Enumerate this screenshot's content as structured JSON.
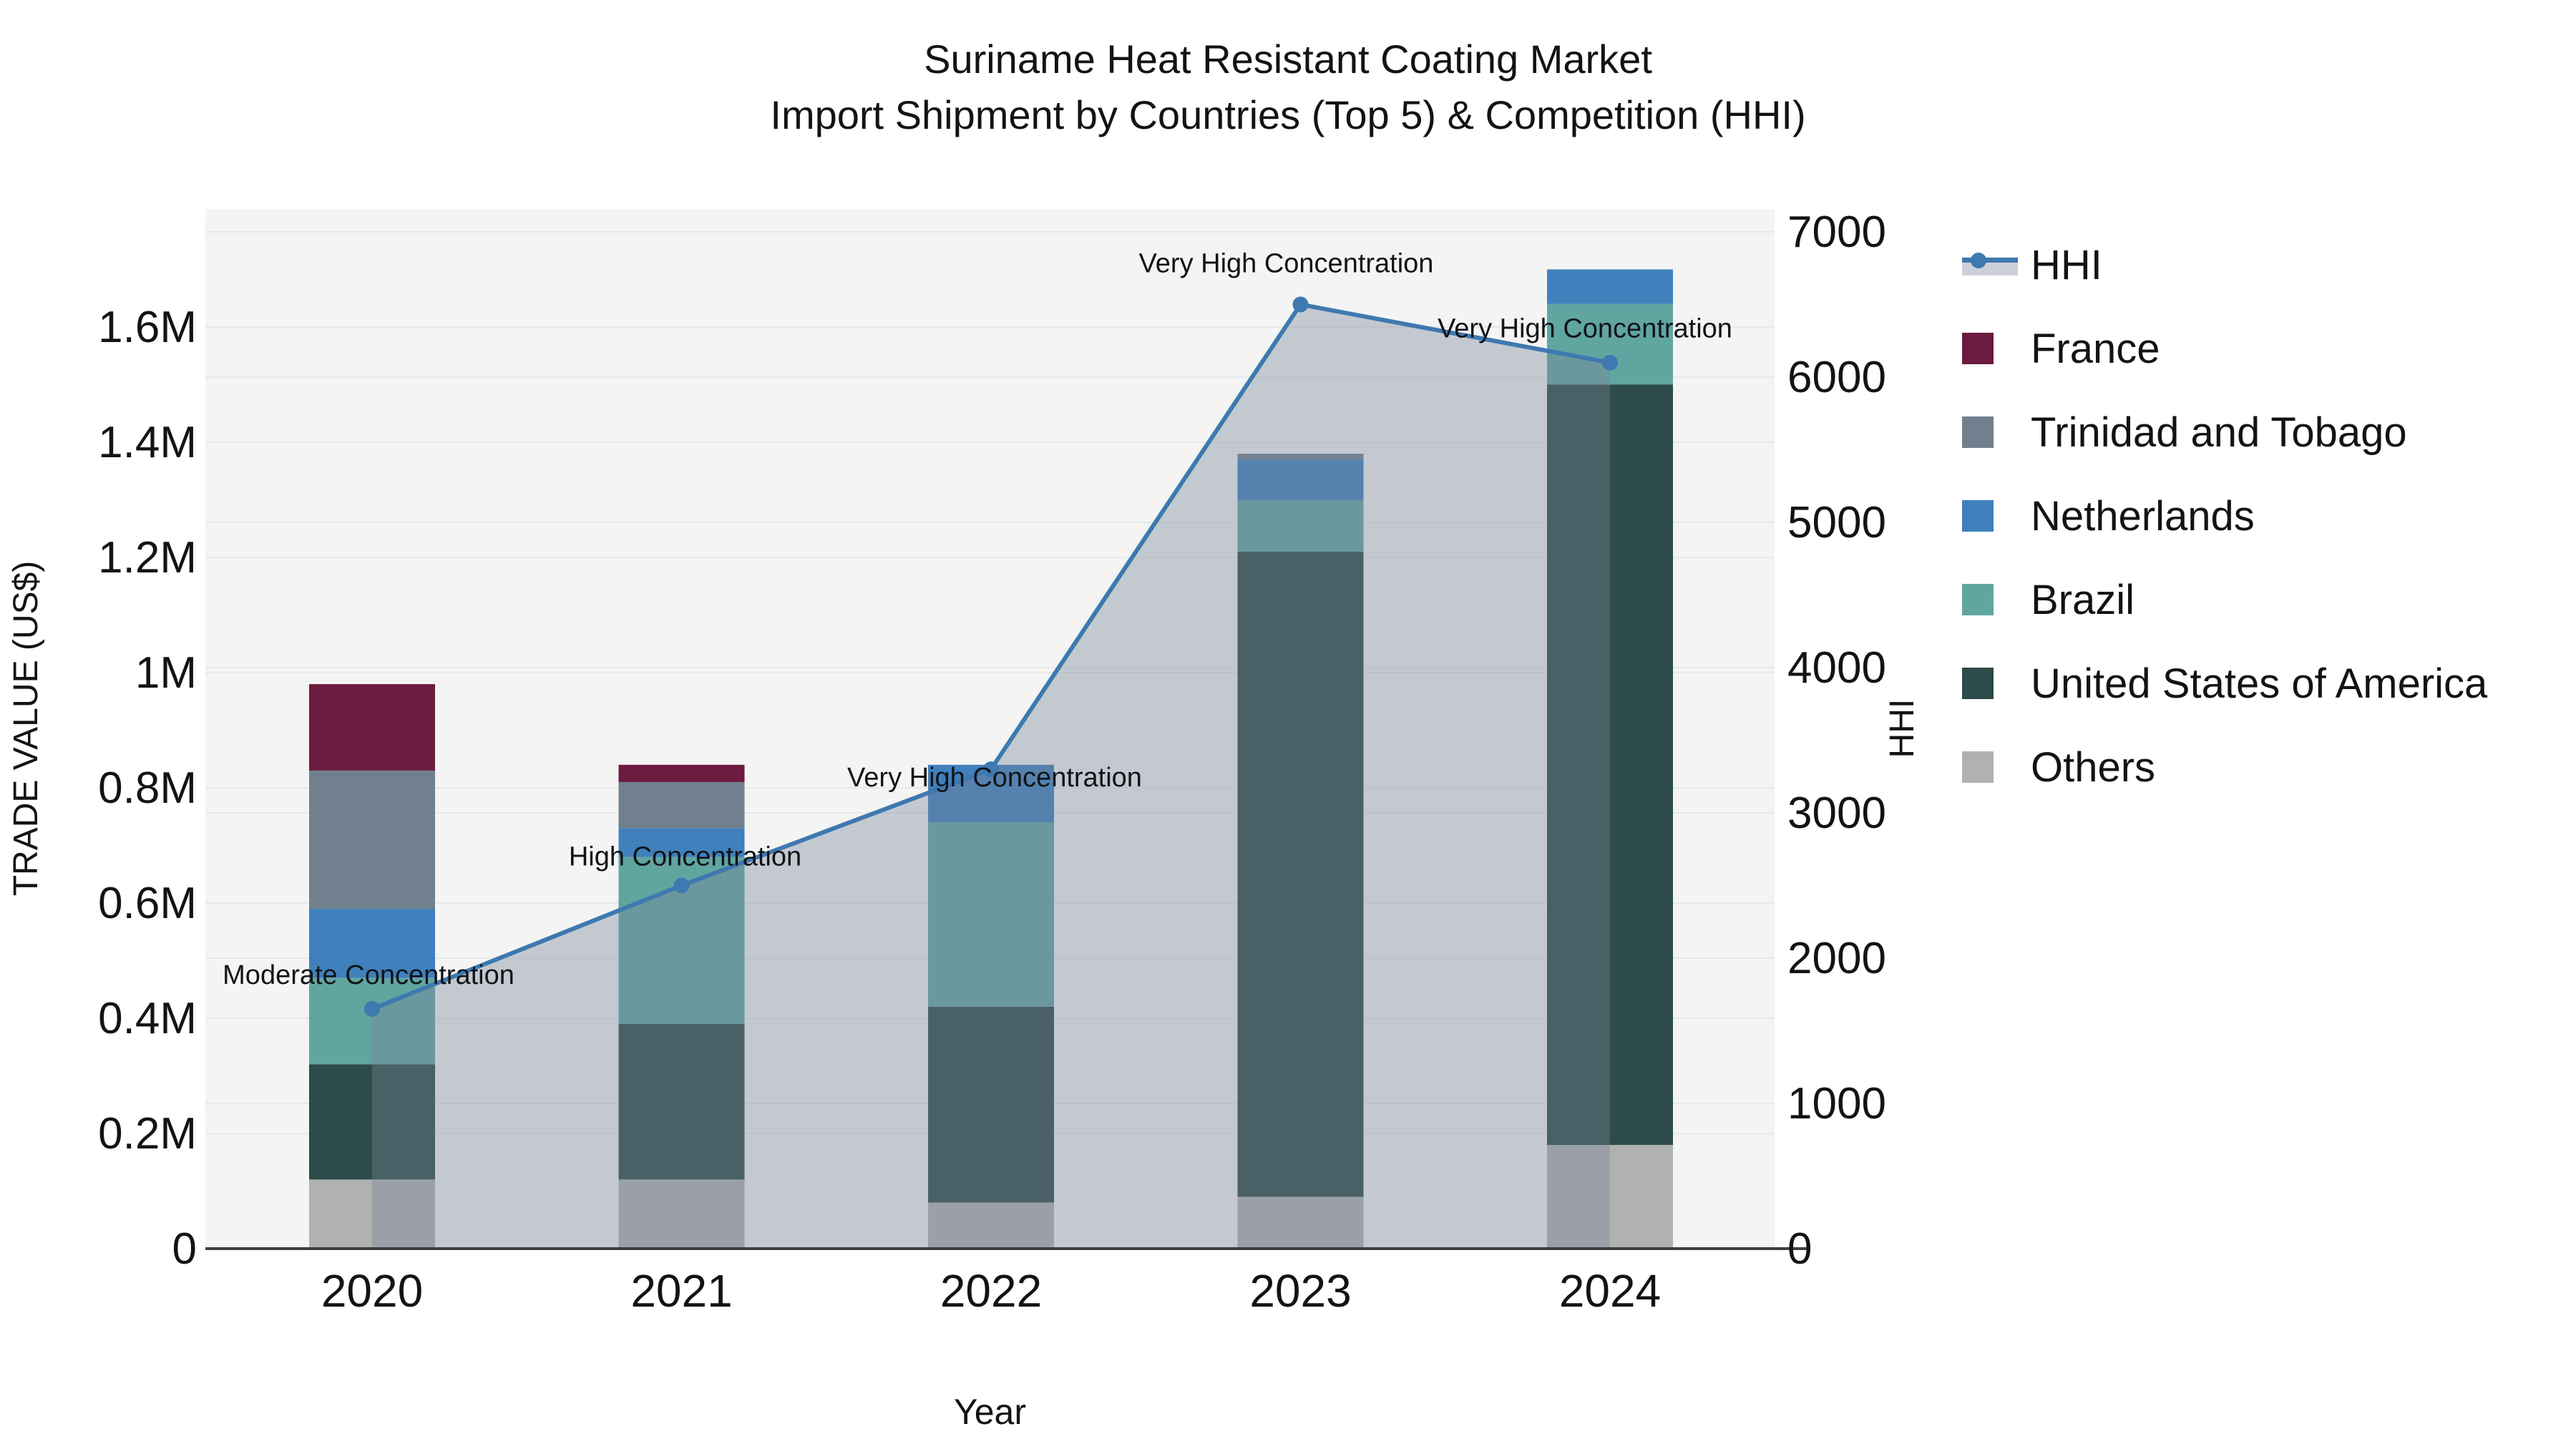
{
  "title": {
    "line1": "Suriname Heat Resistant Coating Market",
    "line2": "Import Shipment by Countries (Top 5) & Competition (HHI)"
  },
  "colors": {
    "page_bg": "#ffffff",
    "plot_bg": "#f3f4f3",
    "gridline": "#e7e8e9",
    "axis_line": "#3f3f3f",
    "text": "#111417",
    "hhi_line": "#3e79b0",
    "hhi_area": "rgba(122,132,155,0.38)",
    "france": "#6b1c3f",
    "trinidad_and_tobago": "#71808f",
    "netherlands": "#4080bc",
    "brazil": "#61a5a1",
    "united_states": "#2d4b48",
    "others": "#b0b2b1"
  },
  "chart_data": {
    "type": "combo: stacked-bar (left axis) + line-area (right axis)",
    "title": "Suriname Heat Resistant Coating Market — Import Shipment by Countries (Top 5) & Competition (HHI)",
    "categories": [
      "2020",
      "2021",
      "2022",
      "2023",
      "2024"
    ],
    "xlabel": "Year",
    "ylabel_left": "TRADE VALUE (US$)",
    "ylabel_right": "HHI",
    "bar_value_unit": "million US$",
    "y_left_ticks": [
      {
        "v": 0.0,
        "label": "0"
      },
      {
        "v": 0.2,
        "label": "0.2M"
      },
      {
        "v": 0.4,
        "label": "0.4M"
      },
      {
        "v": 0.6,
        "label": "0.6M"
      },
      {
        "v": 0.8,
        "label": "0.8M"
      },
      {
        "v": 1.0,
        "label": "1M"
      },
      {
        "v": 1.2,
        "label": "1.2M"
      },
      {
        "v": 1.4,
        "label": "1.4M"
      },
      {
        "v": 1.6,
        "label": "1.6M"
      }
    ],
    "y_right_ticks": [
      {
        "v": 0,
        "label": "0"
      },
      {
        "v": 1000,
        "label": "1000"
      },
      {
        "v": 2000,
        "label": "2000"
      },
      {
        "v": 3000,
        "label": "3000"
      },
      {
        "v": 4000,
        "label": "4000"
      },
      {
        "v": 5000,
        "label": "5000"
      },
      {
        "v": 6000,
        "label": "6000"
      },
      {
        "v": 7000,
        "label": "7000"
      }
    ],
    "ylim_left": [
      0,
      1.8
    ],
    "ylim_right": [
      0,
      7150
    ],
    "grid": true,
    "legend_position": "right",
    "series": [
      {
        "name": "Others",
        "color": "#b0b2b1",
        "values": [
          0.12,
          0.12,
          0.08,
          0.09,
          0.18
        ]
      },
      {
        "name": "United States of America",
        "color": "#2d4b48",
        "values": [
          0.2,
          0.27,
          0.34,
          1.12,
          1.32
        ]
      },
      {
        "name": "Brazil",
        "color": "#61a5a1",
        "values": [
          0.15,
          0.29,
          0.32,
          0.09,
          0.14
        ]
      },
      {
        "name": "Netherlands",
        "color": "#4080bc",
        "values": [
          0.12,
          0.05,
          0.1,
          0.07,
          0.06
        ]
      },
      {
        "name": "Trinidad and Tobago",
        "color": "#71808f",
        "values": [
          0.24,
          0.08,
          0.0,
          0.01,
          0.0
        ]
      },
      {
        "name": "France",
        "color": "#6b1c3f",
        "values": [
          0.15,
          0.03,
          0.0,
          0.0,
          0.0
        ]
      }
    ],
    "bar_totals": [
      0.98,
      0.84,
      0.84,
      1.38,
      1.7
    ],
    "hhi": {
      "name": "HHI",
      "line_color": "#3e79b0",
      "area_color": "rgba(122,132,155,0.38)",
      "values": [
        1650,
        2500,
        3300,
        6500,
        6100
      ],
      "annotations": [
        {
          "text": "Moderate Concentration",
          "dx": -5,
          "dy": -35
        },
        {
          "text": "High Concentration",
          "dx": 5,
          "dy": -28
        },
        {
          "text": "Very High Concentration",
          "dx": 5,
          "dy": 24
        },
        {
          "text": "Very High Concentration",
          "dx": -20,
          "dy": -45
        },
        {
          "text": "Very High Concentration",
          "dx": -35,
          "dy": -35
        }
      ]
    }
  },
  "legend": {
    "items": [
      {
        "label": "HHI",
        "type": "line",
        "color": "#3e79b0"
      },
      {
        "label": "France",
        "type": "swatch",
        "color": "#6b1c3f"
      },
      {
        "label": "Trinidad and Tobago",
        "type": "swatch",
        "color": "#71808f"
      },
      {
        "label": "Netherlands",
        "type": "swatch",
        "color": "#4080bc"
      },
      {
        "label": "Brazil",
        "type": "swatch",
        "color": "#61a5a1"
      },
      {
        "label": "United States of America",
        "type": "swatch",
        "color": "#2d4b48"
      },
      {
        "label": "Others",
        "type": "swatch",
        "color": "#b0b2b1"
      }
    ]
  }
}
